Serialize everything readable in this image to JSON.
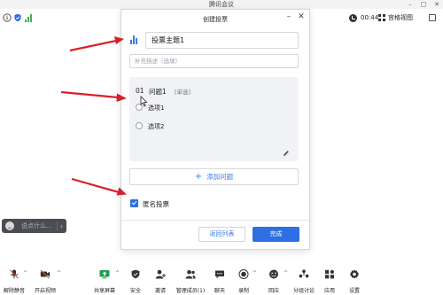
{
  "app": {
    "title": "腾讯会议"
  },
  "top_bar": {
    "timer": "00:44",
    "view_label": "宫格视图"
  },
  "chat": {
    "placeholder": "说点什么...",
    "chevron": "‹"
  },
  "modal": {
    "title": "创建投票",
    "topic_value": "投票主题1",
    "description_placeholder": "补充描述（选填）",
    "question": {
      "number": "01",
      "title": "问题1",
      "type": "[单选]",
      "options": [
        "选项1",
        "选项2"
      ]
    },
    "add_question_label": "添加问题",
    "anonymous_label": "匿名投票",
    "back_label": "返回列表",
    "done_label": "完成"
  },
  "toolbar": [
    {
      "label": "解除静音",
      "icon": "mic-muted-icon"
    },
    {
      "label": "开启视频",
      "icon": "camera-off-icon"
    },
    {
      "label": "共享屏幕",
      "icon": "share-screen-icon"
    },
    {
      "label": "安全",
      "icon": "shield-icon"
    },
    {
      "label": "邀请",
      "icon": "invite-icon"
    },
    {
      "label": "管理成员(1)",
      "icon": "members-icon"
    },
    {
      "label": "聊天",
      "icon": "chat-icon"
    },
    {
      "label": "录制",
      "icon": "record-icon"
    },
    {
      "label": "回应",
      "icon": "reaction-icon"
    },
    {
      "label": "分组讨论",
      "icon": "breakout-icon"
    },
    {
      "label": "应用",
      "icon": "apps-icon"
    },
    {
      "label": "设置",
      "icon": "settings-icon"
    }
  ],
  "colors": {
    "accent": "#2f6fe4",
    "arrow": "#d6212a",
    "signal": "#3bb34a",
    "muted_red": "#e0483d"
  }
}
